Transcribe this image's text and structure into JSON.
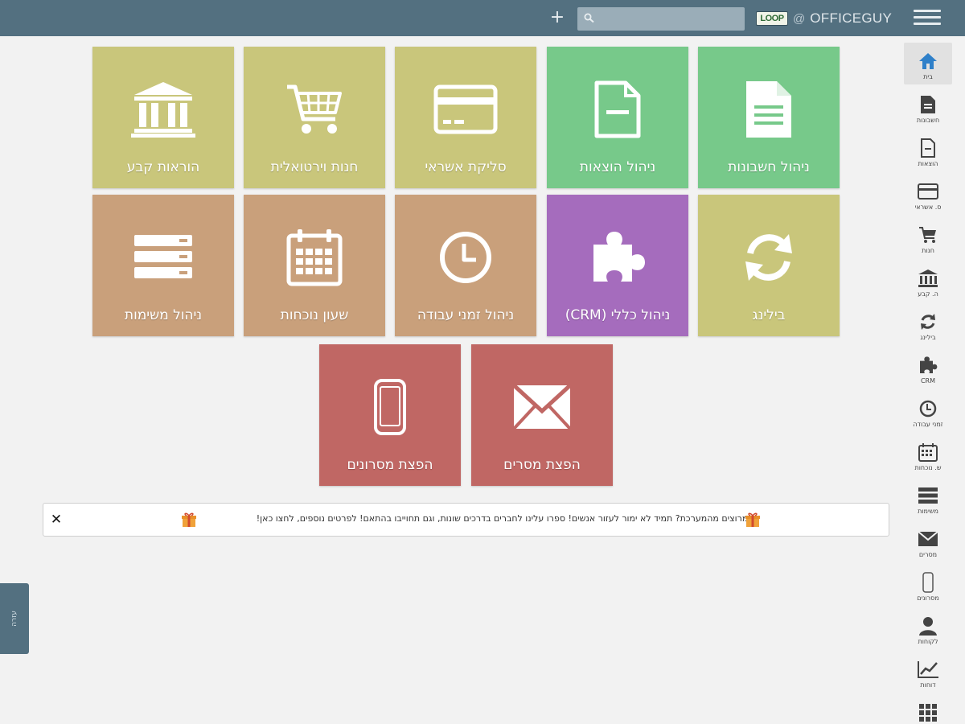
{
  "header": {
    "add_label": "+",
    "search_placeholder": "",
    "brand_logo": "LOOP",
    "brand_at": "@",
    "brand_name": "OFFICEGUY"
  },
  "tiles": [
    {
      "label": "הוראות קבע",
      "icon": "bank-icon",
      "color": "#c9c67b"
    },
    {
      "label": "חנות וירטואלית",
      "icon": "cart-icon",
      "color": "#c9c67b"
    },
    {
      "label": "סליקת אשראי",
      "icon": "credit-card-icon",
      "color": "#c9c67b"
    },
    {
      "label": "ניהול הוצאות",
      "icon": "file-minus-icon",
      "color": "#77c98a"
    },
    {
      "label": "ניהול חשבונות",
      "icon": "document-icon",
      "color": "#77c98a"
    },
    {
      "label": "ניהול משימות",
      "icon": "list-icon",
      "color": "#c9a07b"
    },
    {
      "label": "שעון נוכחות",
      "icon": "calendar-icon",
      "color": "#c9a07b"
    },
    {
      "label": "ניהול זמני עבודה",
      "icon": "clock-icon",
      "color": "#c9a07b"
    },
    {
      "label": "ניהול כללי (CRM)",
      "icon": "puzzle-icon",
      "color": "#a56cbd"
    },
    {
      "label": "בילינג",
      "icon": "refresh-icon",
      "color": "#c9c67b"
    },
    {
      "label": "הפצת מסרונים",
      "icon": "phone-icon",
      "color": "#c06764"
    },
    {
      "label": "הפצת מסרים",
      "icon": "envelope-icon",
      "color": "#c06764"
    }
  ],
  "notice": {
    "text": "מרוצים מהמערכת? תמיד לא ימור לעזור אנשים! ספרו עלינו לחברים בדרכים שונות, וגם תחוייבו בהתאם! לפרטים נוספים, לחצו כאן!",
    "close_label": "✕"
  },
  "side_tab": {
    "label": "עזרה"
  },
  "sidebar": {
    "items": [
      {
        "label": "בית",
        "icon": "home-icon",
        "active": true
      },
      {
        "label": "חשבונות",
        "icon": "document-icon"
      },
      {
        "label": "הוצאות",
        "icon": "file-minus-icon"
      },
      {
        "label": "ס. אשראי",
        "icon": "credit-card-icon"
      },
      {
        "label": "חנות",
        "icon": "cart-icon"
      },
      {
        "label": "ה. קבע",
        "icon": "bank-icon"
      },
      {
        "label": "בילינג",
        "icon": "refresh-icon"
      },
      {
        "label": "CRM",
        "icon": "puzzle-icon"
      },
      {
        "label": "זמני עבודה",
        "icon": "clock-icon"
      },
      {
        "label": "ש. נוכחות",
        "icon": "calendar-icon"
      },
      {
        "label": "משימות",
        "icon": "list-icon"
      },
      {
        "label": "מסרים",
        "icon": "envelope-icon"
      },
      {
        "label": "מסרונים",
        "icon": "phone-icon"
      },
      {
        "label": "לקוחות",
        "icon": "user-icon"
      },
      {
        "label": "דוחות",
        "icon": "chart-icon"
      },
      {
        "label": "",
        "icon": "grid-icon"
      }
    ]
  }
}
